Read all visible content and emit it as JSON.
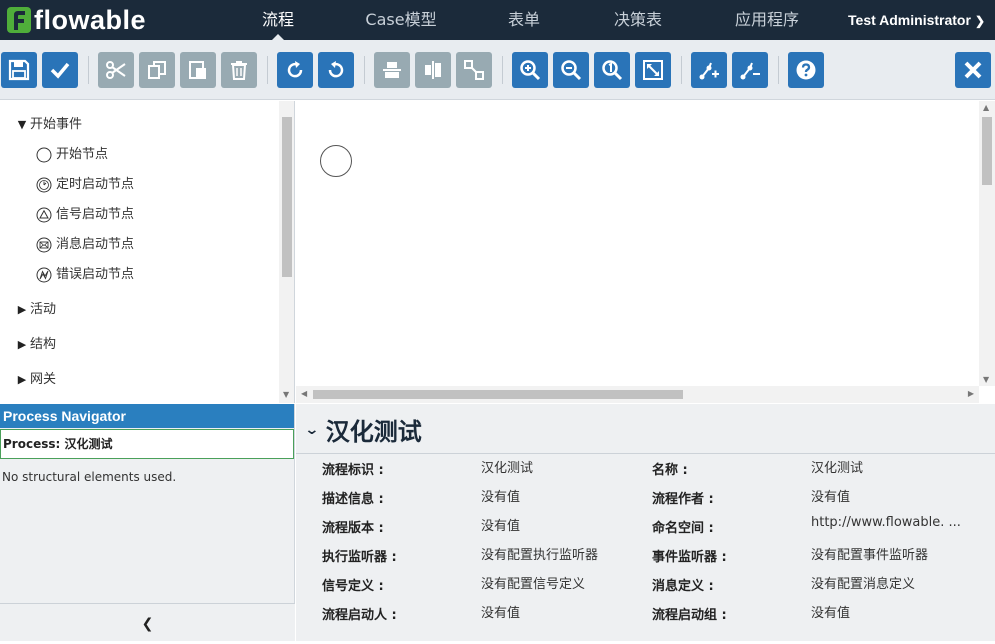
{
  "brand": {
    "logo_text": "flowable"
  },
  "nav": {
    "items": [
      {
        "label": "流程",
        "active": true
      },
      {
        "label": "Case模型",
        "active": false
      },
      {
        "label": "表单",
        "active": false
      },
      {
        "label": "决策表",
        "active": false
      },
      {
        "label": "应用程序",
        "active": false
      }
    ],
    "user": "Test Administrator"
  },
  "toolbar": {
    "buttons": [
      {
        "name": "save-icon",
        "style": "blue"
      },
      {
        "name": "checkmark-icon",
        "style": "blue"
      },
      {
        "name": "cut-icon",
        "style": "gray"
      },
      {
        "name": "copy-icon",
        "style": "gray"
      },
      {
        "name": "paste-icon",
        "style": "gray"
      },
      {
        "name": "delete-icon",
        "style": "gray"
      },
      {
        "name": "redo-icon",
        "style": "blue"
      },
      {
        "name": "undo-icon",
        "style": "blue"
      },
      {
        "name": "align-vertical-icon",
        "style": "gray"
      },
      {
        "name": "align-horizontal-icon",
        "style": "gray"
      },
      {
        "name": "same-size-icon",
        "style": "gray"
      },
      {
        "name": "zoom-in-icon",
        "style": "blue"
      },
      {
        "name": "zoom-out-icon",
        "style": "blue"
      },
      {
        "name": "zoom-actual-icon",
        "style": "blue"
      },
      {
        "name": "zoom-fit-icon",
        "style": "blue"
      },
      {
        "name": "add-bendpoint-icon",
        "style": "blue"
      },
      {
        "name": "remove-bendpoint-icon",
        "style": "blue"
      },
      {
        "name": "help-icon",
        "style": "blue"
      },
      {
        "name": "close-icon",
        "style": "blue"
      }
    ]
  },
  "palette": {
    "groups": [
      {
        "label": "开始事件",
        "expanded": true,
        "items": [
          {
            "label": "开始节点",
            "icon": "none-start-event-icon"
          },
          {
            "label": "定时启动节点",
            "icon": "timer-start-event-icon"
          },
          {
            "label": "信号启动节点",
            "icon": "signal-start-event-icon"
          },
          {
            "label": "消息启动节点",
            "icon": "message-start-event-icon"
          },
          {
            "label": "错误启动节点",
            "icon": "error-start-event-icon"
          }
        ]
      },
      {
        "label": "活动",
        "expanded": false
      },
      {
        "label": "结构",
        "expanded": false
      },
      {
        "label": "网关",
        "expanded": false
      }
    ]
  },
  "navigator": {
    "title": "Process Navigator",
    "process_label": "Process: 汉化测试",
    "empty_text": "No structural elements used.",
    "collapse_icon": "chevron-left-icon"
  },
  "properties": {
    "title": "汉化测试",
    "rows": [
      {
        "label": "流程标识 :",
        "value": "汉化测试",
        "label2": "名称 :",
        "value2": "汉化测试"
      },
      {
        "label": "描述信息 :",
        "value": "没有值",
        "label2": "流程作者 :",
        "value2": "没有值"
      },
      {
        "label": "流程版本 :",
        "value": "没有值",
        "label2": "命名空间 :",
        "value2": "http://www.flowable. ..."
      },
      {
        "label": "执行监听器 :",
        "value": "没有配置执行监听器",
        "label2": "事件监听器 :",
        "value2": "没有配置事件监听器"
      },
      {
        "label": "信号定义 :",
        "value": "没有配置信号定义",
        "label2": "消息定义 :",
        "value2": "没有配置消息定义"
      },
      {
        "label": "流程启动人 :",
        "value": "没有值",
        "label2": "流程启动组 :",
        "value2": "没有值"
      }
    ]
  },
  "colors": {
    "nav_bg": "#1b2a3a",
    "accent_blue": "#2a74b8",
    "disabled_gray": "#98aab2",
    "navigator_header": "#2a7fbf",
    "logo_green": "#4fae3a"
  }
}
